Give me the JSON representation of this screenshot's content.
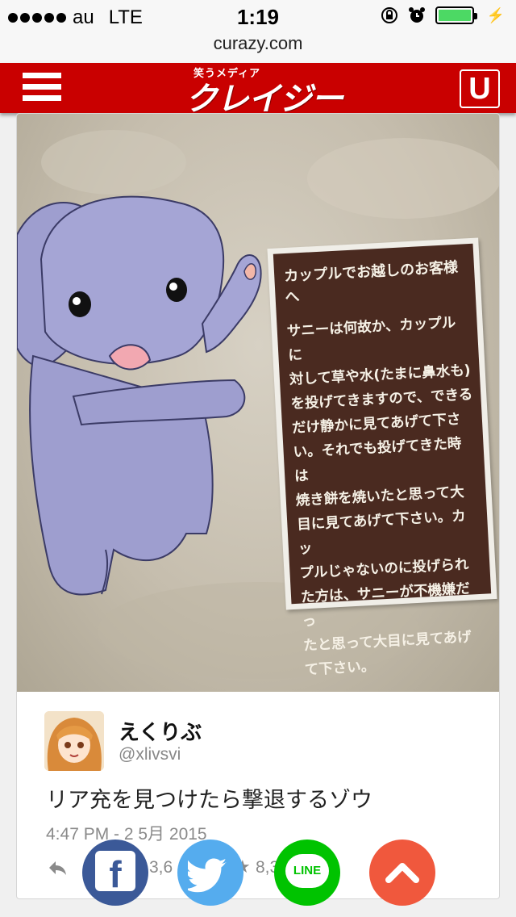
{
  "status_bar": {
    "carrier": "au",
    "network": "LTE",
    "time": "1:19"
  },
  "url_bar": {
    "domain": "curazy.com"
  },
  "header": {
    "logo_tagline": "笑うメディア",
    "logo_name": "クレイジー",
    "u_button": "U",
    "menu_icon": "hamburger-icon"
  },
  "photo": {
    "sign": {
      "title": "カップルでお越しのお客様へ",
      "lines": [
        "サニーは何故か、カップルに",
        "対して草や水(たまに鼻水も)",
        "を投げてきますので、できる",
        "だけ静かに見てあげて下さ",
        "い。それでも投げてきた時は",
        "焼き餅を焼いたと思って大",
        "目に見てあげて下さい。カッ",
        "プルじゃないのに投げられ",
        "た方は、サニーが不機嫌だっ",
        "たと思って大目に見てあげ",
        "て下さい。"
      ]
    }
  },
  "tweet": {
    "name": "えくりぶ",
    "handle": "@xlivsvi",
    "text": "リア充を見つけたら撃退するゾウ",
    "date": "4:47 PM - 2 5月 2015",
    "retweet_count_visible": "3,6",
    "favorite_count_visible": "8,3"
  },
  "share": {
    "facebook": "f",
    "line": "LINE",
    "colors": {
      "facebook": "#3b5998",
      "twitter": "#55acee",
      "line": "#00c300",
      "top": "#f0583d"
    }
  },
  "colors": {
    "header": "#c90000"
  }
}
